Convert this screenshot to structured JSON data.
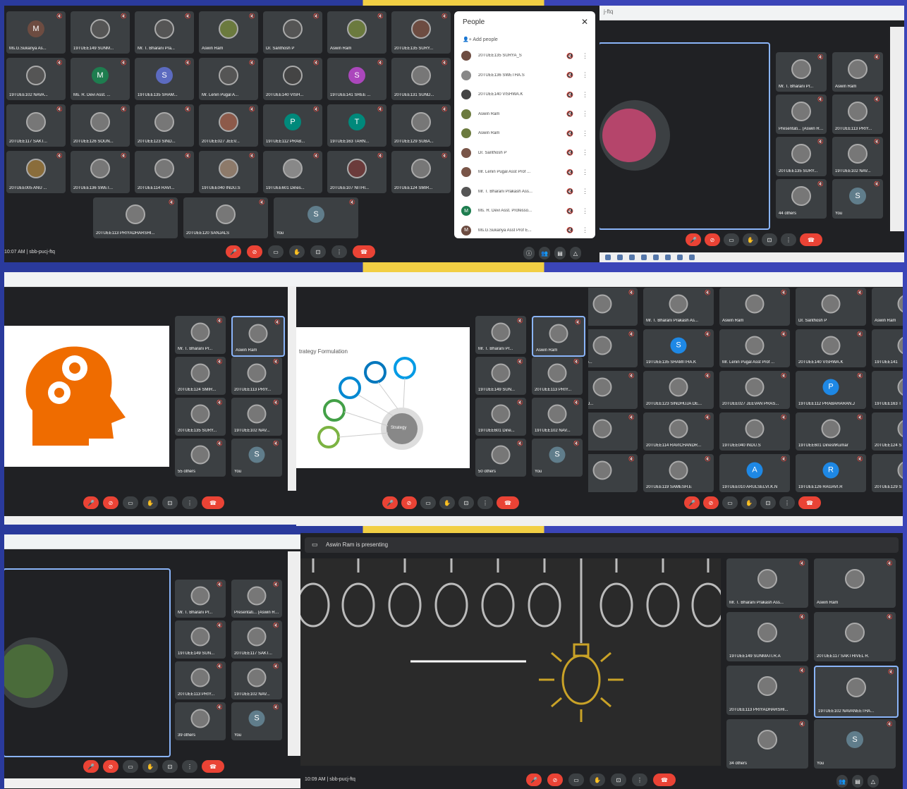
{
  "panel1": {
    "tiles": [
      {
        "name": "Ms.G.Sukanya As...",
        "initial": "M",
        "color": "#6d4c41"
      },
      {
        "name": "19TUEE149 SUNM...",
        "initial": "",
        "color": "#555"
      },
      {
        "name": "Mr. T. Bharani Pra...",
        "initial": "",
        "color": "#555"
      },
      {
        "name": "Aswin Ram",
        "initial": "",
        "color": "#6b7a3e"
      },
      {
        "name": "Dr. Santhosh P",
        "initial": "",
        "color": "#555"
      },
      {
        "name": "Aswin Ram",
        "initial": "",
        "color": "#6b7a3e"
      },
      {
        "name": "20TUEE135 SURY...",
        "initial": "",
        "color": "#6d4c41"
      },
      {
        "name": "19TUEE102 NAVA...",
        "initial": "",
        "color": "#555"
      },
      {
        "name": "Ms. R. Devi Asst. ...",
        "initial": "M",
        "color": "#1e7d4f"
      },
      {
        "name": "19TUEE135 SHAM...",
        "initial": "S",
        "color": "#5c6bc0"
      },
      {
        "name": "Mr. Lenin Pugal A...",
        "initial": "",
        "color": "#555"
      },
      {
        "name": "20TUEE140 VISH...",
        "initial": "",
        "color": "#444"
      },
      {
        "name": "19TUEE141 SREE ...",
        "initial": "S",
        "color": "#ab47bc"
      },
      {
        "name": "20TUEE131 SUND...",
        "initial": "",
        "color": "#777"
      },
      {
        "name": "20TUEE117 SAKT...",
        "initial": "",
        "color": "#777"
      },
      {
        "name": "20TUEE126 SOUN...",
        "initial": "",
        "color": "#777"
      },
      {
        "name": "20TUEE123 SIND...",
        "initial": "",
        "color": "#777"
      },
      {
        "name": "20TUEE027 JEEV...",
        "initial": "",
        "color": "#8d5a4a"
      },
      {
        "name": "19TUEE112 PRAB...",
        "initial": "P",
        "color": "#00897b"
      },
      {
        "name": "19TUEE163 TARN...",
        "initial": "T",
        "color": "#00897b"
      },
      {
        "name": "20TUEE129 SUBA...",
        "initial": "",
        "color": "#777"
      },
      {
        "name": "20TUEE005 ANU ...",
        "initial": "",
        "color": "#8a6d3b"
      },
      {
        "name": "20TUEE136 SWET...",
        "initial": "",
        "color": "#777"
      },
      {
        "name": "20TUEE114 RAVI...",
        "initial": "",
        "color": "#777"
      },
      {
        "name": "19TUEE040 INDU.S",
        "initial": "",
        "color": "#8d7a6a"
      },
      {
        "name": "19TUEE601 Dines...",
        "initial": "",
        "color": "#888"
      },
      {
        "name": "20TUEE107 NITHI...",
        "initial": "",
        "color": "#6b3b3b"
      },
      {
        "name": "20TUEE124 SMIR...",
        "initial": "",
        "color": "#777"
      }
    ],
    "bottom_tiles": [
      {
        "name": "20TUEE113 PRIYADHARSHI...",
        "initial": ""
      },
      {
        "name": "20TUEE120 SANJALS",
        "initial": ""
      },
      {
        "name": "You",
        "initial": "S"
      }
    ],
    "time": "10:07 AM",
    "meeting_code": "sbb-pucj-ftq"
  },
  "people_panel": {
    "title": "People",
    "add_label": "Add people",
    "close": "✕",
    "rows": [
      {
        "name": "20TUEE135 SURYA_S",
        "initial": "",
        "color": "#6d4c41"
      },
      {
        "name": "20TUEE136 SWETHA.S",
        "initial": "",
        "color": "#888"
      },
      {
        "name": "20TUEE140 VISHWA.K",
        "initial": "",
        "color": "#444"
      },
      {
        "name": "Aswin Ram",
        "initial": "",
        "color": "#6b7a3e"
      },
      {
        "name": "Aswin Ram",
        "initial": "",
        "color": "#6b7a3e"
      },
      {
        "name": "Dr. Santhosh P",
        "initial": "",
        "color": "#795548"
      },
      {
        "name": "Mr. Lenin Pugal Asst Prof ...",
        "initial": "",
        "color": "#795548"
      },
      {
        "name": "Mr. T. Bharani Prakash Ass...",
        "initial": "",
        "color": "#555"
      },
      {
        "name": "Ms. R. Devi Asst. Professo...",
        "initial": "M",
        "color": "#1e7d4f"
      },
      {
        "name": "Ms.G.Sukanya Asst Prof E...",
        "initial": "M",
        "color": "#6d4c41"
      }
    ]
  },
  "panel2": {
    "side_tiles": [
      {
        "name": "Mr. T. Bharani Pr...",
        "initial": ""
      },
      {
        "name": "Aswin Ram",
        "initial": ""
      },
      {
        "name": "Presentati... (Aswin Ra...",
        "initial": ""
      },
      {
        "name": "20TUEE113 PRIY...",
        "initial": ""
      },
      {
        "name": "20TUEE135 SURY...",
        "initial": ""
      },
      {
        "name": "19TUEE102 NAV...",
        "initial": ""
      },
      {
        "name": "44 others",
        "initial": ""
      },
      {
        "name": "You",
        "initial": "S"
      }
    ]
  },
  "panel3": {
    "side_tiles": [
      {
        "name": "Mr. T. Bharani Pr...",
        "initial": ""
      },
      {
        "name": "Aswin Ram",
        "initial": ""
      },
      {
        "name": "20TUEE124 SMIR...",
        "initial": ""
      },
      {
        "name": "20TUEE113 PRIY...",
        "initial": ""
      },
      {
        "name": "20TUEE135 SURY...",
        "initial": ""
      },
      {
        "name": "19TUEE102 NAV...",
        "initial": ""
      },
      {
        "name": "55 others",
        "initial": ""
      },
      {
        "name": "You",
        "initial": "S"
      }
    ]
  },
  "panel4": {
    "slide_title": "trategy Formulation",
    "center_label": "Strategy",
    "side_tiles": [
      {
        "name": "Mr. T. Bharani Pr...",
        "initial": ""
      },
      {
        "name": "Aswin Ram",
        "initial": ""
      },
      {
        "name": "19TUEE149 SUN...",
        "initial": ""
      },
      {
        "name": "20TUEE113 PRIY...",
        "initial": ""
      },
      {
        "name": "19TUEE601 Dine...",
        "initial": ""
      },
      {
        "name": "19TUEE102 NAV...",
        "initial": ""
      },
      {
        "name": "50 others",
        "initial": ""
      },
      {
        "name": "You",
        "initial": "S"
      }
    ]
  },
  "panel5": {
    "tiles": [
      {
        "name": "MATI.R.A",
        "initial": ""
      },
      {
        "name": "Mr. T. Bharani Prakash As...",
        "initial": ""
      },
      {
        "name": "Aswin Ram",
        "initial": ""
      },
      {
        "name": "Dr. Santhosh P",
        "initial": ""
      },
      {
        "name": "Aswin Ram",
        "initial": ""
      },
      {
        "name": "i Professo...",
        "initial": ""
      },
      {
        "name": "19TUEE135 SHAMITHA.K",
        "initial": "S"
      },
      {
        "name": "Mr. Lenin Pugal Asst Prof ...",
        "initial": ""
      },
      {
        "name": "20TUEE140 VISHWA.K",
        "initial": ""
      },
      {
        "name": "19TUEE141",
        "initial": ""
      },
      {
        "name": "UNDARAJ...",
        "initial": ""
      },
      {
        "name": "20TUEE123 SINDHUJA DE...",
        "initial": ""
      },
      {
        "name": "20TUEE027 JEEVAN PRAS...",
        "initial": ""
      },
      {
        "name": "19TUEE112 PRABAHARAN.J",
        "initial": "P"
      },
      {
        "name": "19TUEE163 T",
        "initial": ""
      },
      {
        "name": "IVYA S.",
        "initial": ""
      },
      {
        "name": "20TUEE114 RAVICHANDR...",
        "initial": ""
      },
      {
        "name": "19TUEE040 INDU.S",
        "initial": ""
      },
      {
        "name": "19TUEE601 DineshKumar",
        "initial": ""
      },
      {
        "name": "20TUEE124 S",
        "initial": ""
      },
      {
        "name": "IYA.P",
        "initial": ""
      },
      {
        "name": "20TUEE119 SAMESH.E",
        "initial": ""
      },
      {
        "name": "19TUEE010 ARULSELVI.K.N",
        "initial": "A"
      },
      {
        "name": "19TUEE126 RAGAVI.R",
        "initial": "R"
      },
      {
        "name": "20TUEE129 S",
        "initial": ""
      }
    ]
  },
  "panel6": {
    "side_tiles": [
      {
        "name": "Mr. T. Bharani Pr...",
        "initial": ""
      },
      {
        "name": "Presentati... (Aswin Ra...",
        "initial": ""
      },
      {
        "name": "19TUEE149 SUN...",
        "initial": ""
      },
      {
        "name": "20TUEE117 SAKT...",
        "initial": ""
      },
      {
        "name": "20TUEE113 PRIY...",
        "initial": ""
      },
      {
        "name": "19TUEE102 NAV...",
        "initial": ""
      },
      {
        "name": "39 others",
        "initial": ""
      },
      {
        "name": "You",
        "initial": "S"
      }
    ]
  },
  "panel7": {
    "presenting_label": "Aswin Ram is presenting",
    "side_tiles": [
      {
        "name": "Mr. T. Bharani Prakash Ass...",
        "initial": ""
      },
      {
        "name": "Aswin Ram",
        "initial": ""
      },
      {
        "name": "19TUEE149 SUNMATI.R.A",
        "initial": ""
      },
      {
        "name": "20TUEE117 SAKTHIVEL R.",
        "initial": ""
      },
      {
        "name": "20TUEE113 PRIYADHARSHI...",
        "initial": ""
      },
      {
        "name": "19TUEE102 NAVANEETHA...",
        "initial": ""
      },
      {
        "name": "34 others",
        "initial": ""
      },
      {
        "name": "You",
        "initial": "S"
      }
    ],
    "time": "10:09 AM",
    "meeting_code": "sbb-pucj-ftq"
  },
  "labels": {
    "url_fragment": "j-ftq"
  }
}
